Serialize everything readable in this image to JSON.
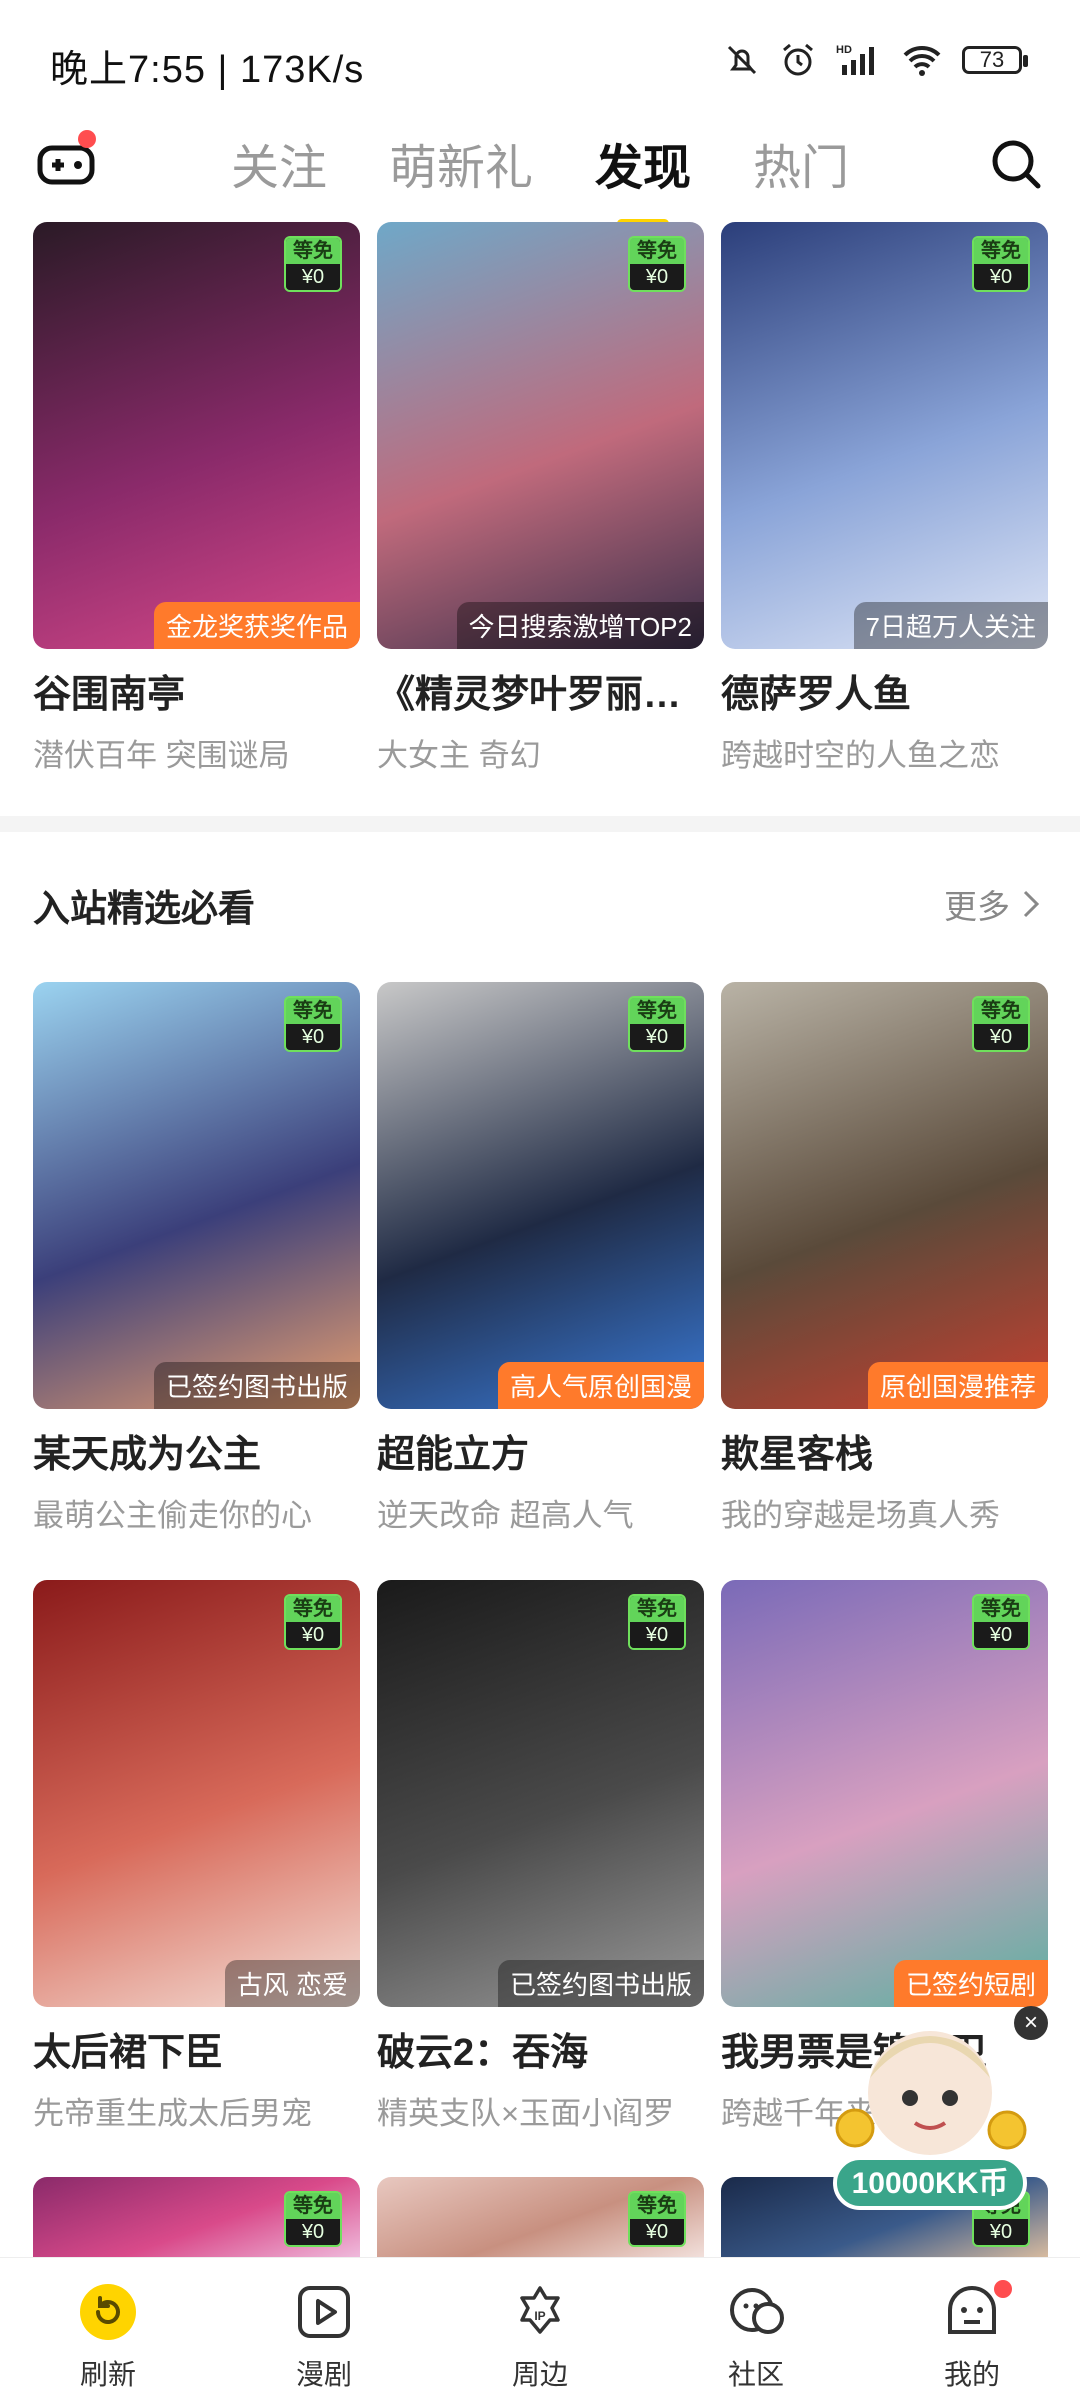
{
  "status_bar": {
    "time": "晚上7:55 | 173K/s",
    "battery": "73"
  },
  "nav": {
    "tabs": [
      "关注",
      "萌新礼",
      "发现",
      "热门"
    ],
    "active_tab": "发现"
  },
  "free_badge": {
    "top": "等免",
    "bottom": "¥0"
  },
  "row1": [
    {
      "title": "谷围南亭",
      "subtitle": "潜伏百年 突围谜局",
      "tag": "金龙奖获奖作品",
      "tag_style": "orange",
      "colors": [
        "#2a1a26",
        "#8a2a6a",
        "#d94a8a"
      ]
    },
    {
      "title": "《精灵梦叶罗丽…",
      "subtitle": "大女主 奇幻",
      "tag": "今日搜索激增TOP2",
      "tag_style": "dark",
      "colors": [
        "#6fa8c8",
        "#c06a7c",
        "#3a2f4a"
      ]
    },
    {
      "title": "德萨罗人鱼",
      "subtitle": "跨越时空的人鱼之恋",
      "tag": "7日超万人关注",
      "tag_style": "dark",
      "colors": [
        "#2b3e7a",
        "#8aa4d8",
        "#dfe6f6"
      ]
    }
  ],
  "section": {
    "title": "入站精选必看",
    "more": "更多"
  },
  "row2": [
    {
      "title": "某天成为公主",
      "subtitle": "最萌公主偷走你的心",
      "tag": "已签约图书出版",
      "tag_style": "dark",
      "colors": [
        "#9bd3f0",
        "#3b3f7a",
        "#e8a070"
      ]
    },
    {
      "title": "超能立方",
      "subtitle": "逆天改命 超高人气",
      "tag": "高人气原创国漫",
      "tag_style": "orange",
      "colors": [
        "#c8c8c8",
        "#1f2a44",
        "#3a7ad6"
      ]
    },
    {
      "title": "欺星客栈",
      "subtitle": "我的穿越是场真人秀",
      "tag": "原创国漫推荐",
      "tag_style": "orange",
      "colors": [
        "#b9b3a6",
        "#5a4a3a",
        "#c64030"
      ]
    }
  ],
  "row3": [
    {
      "title": "太后裙下臣",
      "subtitle": "先帝重生成太后男宠",
      "tag": "古风 恋爱",
      "tag_style": "dark",
      "colors": [
        "#8a1a1a",
        "#d86a5a",
        "#f4e0d8"
      ]
    },
    {
      "title": "破云2：吞海",
      "subtitle": "精英支队×玉面小阎罗",
      "tag": "已签约图书出版",
      "tag_style": "dark",
      "colors": [
        "#1a1a1a",
        "#4a4a4a",
        "#9a9a9a"
      ]
    },
    {
      "title": "我男票是锦衣卫",
      "subtitle": "跨越千年来爱你",
      "tag": "已签约短剧",
      "tag_style": "orange",
      "colors": [
        "#7a6ab8",
        "#d8a0c0",
        "#5ab0a0"
      ]
    }
  ],
  "row4": [
    {
      "colors": [
        "#8a2a6a",
        "#d94a8a",
        "#f0c0e0"
      ]
    },
    {
      "colors": [
        "#e8c8c0",
        "#c89080",
        "#f4e4e0"
      ]
    },
    {
      "colors": [
        "#1a2a4a",
        "#3a5a8a",
        "#e0c0a0"
      ]
    }
  ],
  "promo": {
    "label": "10000KK币"
  },
  "bottom_nav": [
    {
      "label": "刷新",
      "icon": "refresh-icon"
    },
    {
      "label": "漫剧",
      "icon": "play-icon"
    },
    {
      "label": "周边",
      "icon": "ip-icon"
    },
    {
      "label": "社区",
      "icon": "community-icon"
    },
    {
      "label": "我的",
      "icon": "profile-icon"
    }
  ],
  "accent_color": "#ffd400"
}
